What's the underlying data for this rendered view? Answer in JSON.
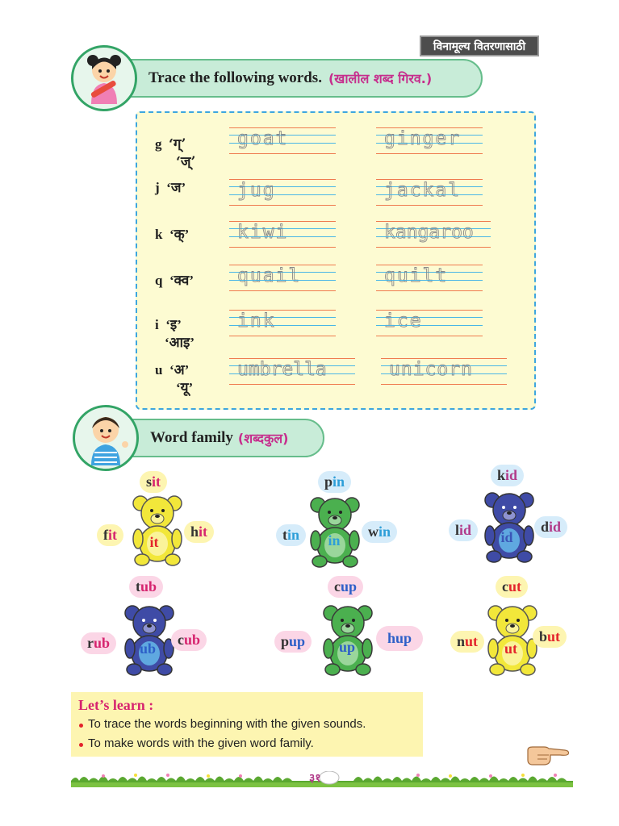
{
  "stamp": "विनामूल्य वितरणासाठी",
  "section1": {
    "title_en": "Trace the following words.",
    "title_mr": "(खालील शब्द गिरव.)",
    "rows": [
      {
        "letter": "g",
        "sounds": [
          "‘ग्’",
          "‘ज्’"
        ],
        "words": [
          "goat",
          "ginger"
        ]
      },
      {
        "letter": "j",
        "sounds": [
          "‘ज’"
        ],
        "words": [
          "jug",
          "jackal"
        ]
      },
      {
        "letter": "k",
        "sounds": [
          "‘क्’"
        ],
        "words": [
          "kiwi",
          "kangaroo"
        ]
      },
      {
        "letter": "q",
        "sounds": [
          "‘क्व’"
        ],
        "words": [
          "quail",
          "quilt"
        ]
      },
      {
        "letter": "i",
        "sounds": [
          "‘इ’",
          "‘आइ’"
        ],
        "words": [
          "ink",
          "ice"
        ]
      },
      {
        "letter": "u",
        "sounds": [
          "‘अ’",
          "‘यू’"
        ],
        "words": [
          "umbrella",
          "unicorn"
        ]
      }
    ]
  },
  "section2": {
    "title_en": "Word family",
    "title_mr": "(शब्दकुल)",
    "families": [
      {
        "family": "it",
        "words": [
          {
            "start": "s",
            "end": "it"
          },
          {
            "start": "f",
            "end": "it"
          },
          {
            "start": "h",
            "end": "it"
          }
        ]
      },
      {
        "family": "in",
        "words": [
          {
            "start": "p",
            "end": "in"
          },
          {
            "start": "t",
            "end": "in"
          },
          {
            "start": "w",
            "end": "in"
          }
        ]
      },
      {
        "family": "id",
        "words": [
          {
            "start": "k",
            "end": "id"
          },
          {
            "start": "l",
            "end": "id"
          },
          {
            "start": "d",
            "end": "id"
          }
        ]
      },
      {
        "family": "ub",
        "words": [
          {
            "start": "t",
            "end": "ub"
          },
          {
            "start": "r",
            "end": "ub"
          },
          {
            "start": "c",
            "end": "ub"
          }
        ]
      },
      {
        "family": "up",
        "words": [
          {
            "start": "c",
            "end": "up"
          },
          {
            "start": "p",
            "end": "up"
          },
          {
            "start": "h",
            "end": "up"
          }
        ]
      },
      {
        "family": "ut",
        "words": [
          {
            "start": "c",
            "end": "ut"
          },
          {
            "start": "n",
            "end": "ut"
          },
          {
            "start": "b",
            "end": "ut"
          }
        ]
      }
    ]
  },
  "lets_learn": {
    "title": "Let’s learn :",
    "items": [
      "To trace the words beginning with the given sounds.",
      "To make words with the given word family."
    ]
  },
  "page_number": "३१",
  "colors": {
    "title_band": "#c8ecd8",
    "title_border": "#66bd8b",
    "marathi_text": "#c62e8d",
    "trace_box_bg": "#fdfbd2",
    "trace_box_border": "#3ea6de",
    "line_orange": "#ef7b4f",
    "line_blue": "#4ab6e6",
    "learn_bg": "#fdf5b1",
    "learn_title": "#d6246f",
    "bear_yellow": "#f2e73a",
    "bear_green": "#4bb04f",
    "bear_blue": "#3f4ba6"
  }
}
